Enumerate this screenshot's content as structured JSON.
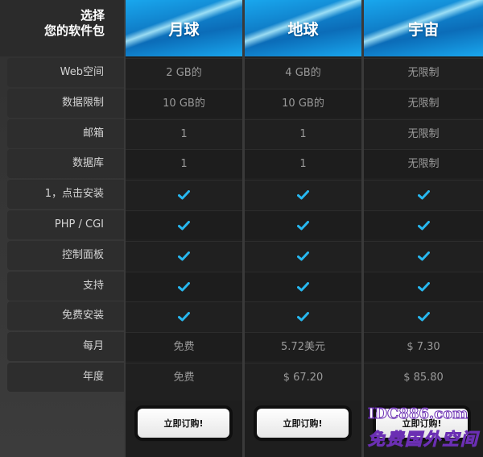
{
  "header": {
    "title_line1": "选择",
    "title_line2": "您的软件包"
  },
  "plans": [
    {
      "name": "月球",
      "button_label": "立即订购!"
    },
    {
      "name": "地球",
      "button_label": "立即订购!"
    },
    {
      "name": "宇宙",
      "button_label": "立即订购!"
    }
  ],
  "rows": [
    {
      "label": "Web空间",
      "values": [
        "2 GB的",
        "4 GB的",
        "无限制"
      ]
    },
    {
      "label": "数据限制",
      "values": [
        "10 GB的",
        "10 GB的",
        "无限制"
      ]
    },
    {
      "label": "邮箱",
      "values": [
        "1",
        "1",
        "无限制"
      ]
    },
    {
      "label": "数据库",
      "values": [
        "1",
        "1",
        "无限制"
      ]
    },
    {
      "label": "1，点击安装",
      "values": [
        "check",
        "check",
        "check"
      ]
    },
    {
      "label": "PHP / CGI",
      "values": [
        "check",
        "check",
        "check"
      ]
    },
    {
      "label": "控制面板",
      "values": [
        "check",
        "check",
        "check"
      ]
    },
    {
      "label": "支持",
      "values": [
        "check",
        "check",
        "check"
      ]
    },
    {
      "label": "免费安装",
      "values": [
        "check",
        "check",
        "check"
      ]
    },
    {
      "label": "每月",
      "values": [
        "免费",
        "5.72美元",
        "$ 7.30"
      ]
    },
    {
      "label": "年度",
      "values": [
        "免费",
        "$ 67.20",
        "$ 85.80"
      ]
    }
  ],
  "watermark": {
    "line1": "IDC886.com",
    "line2": "免费国外空间"
  },
  "colors": {
    "accent": "#19a7ee",
    "check": "#27b8f0",
    "panel": "#202020"
  }
}
